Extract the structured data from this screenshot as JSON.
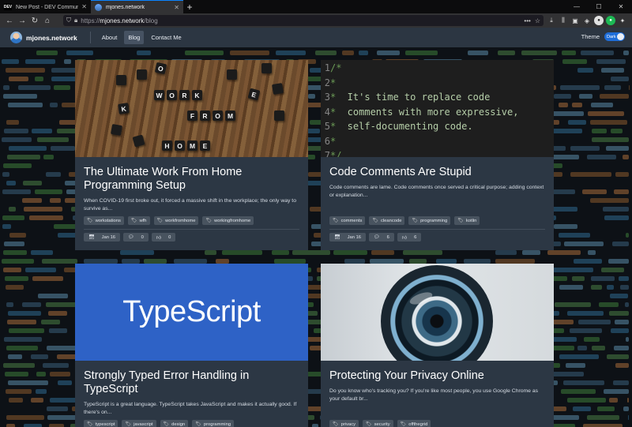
{
  "browser": {
    "tabs": [
      {
        "favicon": "DEV",
        "label": "New Post - DEV Community 👩‍💻👨‍💻",
        "close": "✕"
      },
      {
        "favicon": "",
        "label": "mjones.network",
        "close": "✕"
      }
    ],
    "new_tab": "+",
    "url_scheme": "https://",
    "url_host": "mjones.network",
    "url_path": "/blog"
  },
  "site": {
    "brand": "mjones.network",
    "menu": [
      {
        "label": "About",
        "active": false
      },
      {
        "label": "Blog",
        "active": true
      },
      {
        "label": "Contact Me",
        "active": false
      }
    ],
    "theme_label": "Theme",
    "theme_value": "Dark"
  },
  "posts": [
    {
      "title": "The Ultimate Work From Home Programming Setup",
      "excerpt": "When COVID-19 first broke out, it forced a massive shift in the workplace; the only way to survive as...",
      "tags": [
        "workstations",
        "wfh",
        "workfromhome",
        "workingfromhome"
      ],
      "date": "Jan 16",
      "comments": "0",
      "reactions": "0",
      "image_words": [
        "W",
        "O",
        "R",
        "K",
        "F",
        "R",
        "O",
        "M",
        "H",
        "O",
        "M",
        "E"
      ]
    },
    {
      "title": "Code Comments Are Stupid",
      "excerpt": "Code comments are lame. Code comments once served a critical purpose; adding context or explanation...",
      "tags": [
        "comments",
        "cleancode",
        "programming",
        "kotlin"
      ],
      "date": "Jan 16",
      "comments": "6",
      "reactions": "6",
      "code_lines": [
        {
          "n": "1",
          "c": "/*",
          "t": ""
        },
        {
          "n": "2",
          "c": "*",
          "t": ""
        },
        {
          "n": "3",
          "c": "*",
          "t": "  It's time to replace code"
        },
        {
          "n": "4",
          "c": "*",
          "t": "  comments with more expressive,"
        },
        {
          "n": "5",
          "c": "*",
          "t": "  self-documenting code."
        },
        {
          "n": "6",
          "c": "*",
          "t": ""
        },
        {
          "n": "7",
          "c": "*/",
          "t": ""
        }
      ]
    },
    {
      "title": "Strongly Typed Error Handling in TypeScript",
      "excerpt": "TypeScript is a great language. TypeScript takes JavaScript and makes it actually good. If there's on...",
      "tags": [
        "typescript",
        "javascript",
        "design",
        "programming"
      ],
      "image_text": "TypeScript"
    },
    {
      "title": "Protecting Your Privacy Online",
      "excerpt": "Do you know who's tracking you? If you're like most people, you use Google Chrome as your default br...",
      "tags": [
        "privacy",
        "security",
        "offthegrid"
      ]
    }
  ],
  "colors": {
    "accent": "#1e6dd8",
    "card_bg": "#2c3744",
    "header_bg": "#2c3642"
  },
  "icons": {
    "tag": "tag-icon",
    "calendar": "calendar-icon",
    "comment": "comment-icon",
    "reaction": "thumbs-up-icon"
  }
}
